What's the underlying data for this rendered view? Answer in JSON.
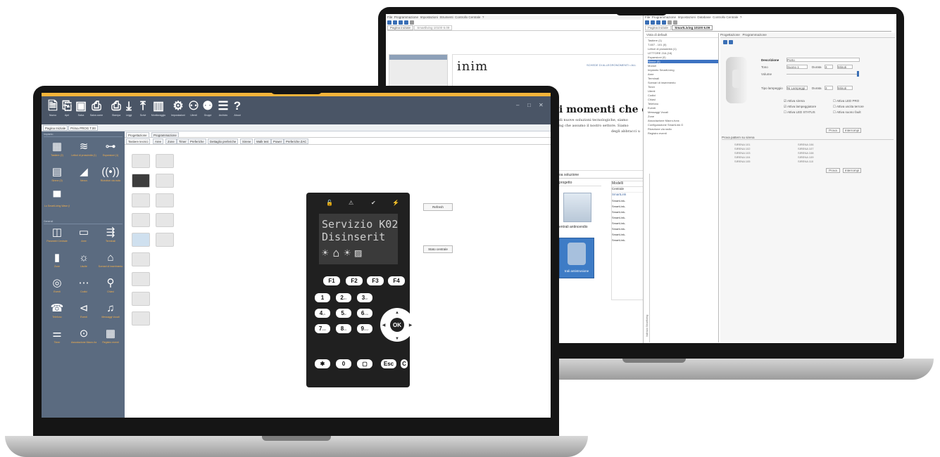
{
  "back_app": {
    "menu": [
      "File",
      "Programmazione",
      "Impostazioni",
      "Strumenti",
      "Controllo Centrale",
      "?"
    ],
    "menu_right": [
      "File",
      "Programmazione",
      "Impostazioni",
      "Database",
      "Controllo Centrale",
      "?"
    ],
    "tabs_left": [
      "Pagina iniziale",
      "Smartliving 10100 6.09"
    ],
    "tabs_right": [
      "Pagina iniziale",
      "SmartLiving 10100 6.09"
    ],
    "brand_logo": "inim",
    "web_link": "SCHEDE DI ALLEGRONOMENTI • ALL",
    "headline": "i momenti che con",
    "paragraph_1": "di nuove soluzioni tecnologiche, siamo",
    "paragraph_2": "ng che assumo il nostro settore. Siamo",
    "paragraph_3": "degli abbracci u",
    "solution_label": "oa soluzione",
    "project_label": "progetto",
    "models_label": "Modelli",
    "central_label": "Centrale",
    "smartlink_header": "SmartLink",
    "smartlink_items": [
      "SmartLink-",
      "SmartLink-",
      "SmartLink-",
      "SmartLink-",
      "SmartLink-",
      "SmartLink-",
      "SmartLink-",
      "SmartLink-"
    ],
    "central_caption_1": "entrali antincendio",
    "central_caption_2": "trali antintrusione",
    "tree_title": "Vista di default",
    "tree_items": [
      "Tastiere (1)",
      "T-607 - 101 (0)",
      "Lettori di prossimità (1)",
      "LETTORE 216 (16)",
      "Espansioni (0)",
      "Sirene (0)",
      "Moduli",
      "Impianto SmartLiving",
      "Aree",
      "Terminali",
      "Scenari di inserimento",
      "Timer",
      "Utenti",
      "Codici",
      "Chiavi",
      "Telefono",
      "Eventi",
      "Messaggi Vocali",
      "Zone",
      "Associazione Macro-funz.",
      "Configurazione SmartLink G",
      "Ricezione via radio",
      "Registro eventi"
    ],
    "prog_tabs": [
      "Progettazione",
      "Programmazione"
    ],
    "field_description": "Descrizione",
    "field_description_value": "Porto",
    "field_tone": "Tono",
    "field_tone_value": "Suono 1",
    "field_duration": "Durata",
    "field_duration_value": "3",
    "field_unit": "Minuti",
    "field_volume": "Volume",
    "field_blink_type": "Tipo lampeggio",
    "field_blink_value": "Ni Lampeggi",
    "field_duration_2_value": "3",
    "chk_sirena": "Attiva sirena",
    "chk_lampeggiatore": "Attiva lampeggiatore",
    "chk_led_status": "Attiva LED STATUS",
    "chk_led_pro": "Attiva LED PRO",
    "chk_uscita": "Attiva uscita terrore",
    "chk_guasti": "Attiva suono fault",
    "btn_prova": "Prova",
    "btn_interrompi": "Interrompi",
    "pattern_title": "Prova pattern su sirena",
    "pattern_left": [
      "SIRENA 101",
      "SIRENA 102",
      "SIRENA 103",
      "SIRENA 104",
      "SIRENA 105"
    ],
    "pattern_right": [
      "SIRENA 106",
      "SIRENA 107",
      "SIRENA 108",
      "SIRENA 109",
      "SIRENA 110"
    ],
    "btn_prova_2": "Prova",
    "btn_interrompi_2": "Interrompi",
    "side_label": "Indirizzo Smartliving"
  },
  "front_app": {
    "toolbar": [
      {
        "label": "Nuovo",
        "icon": "new-document-icon",
        "glyph": "🗎"
      },
      {
        "label": "Apri",
        "icon": "open-icon",
        "glyph": "⎘"
      },
      {
        "label": "Salva",
        "icon": "save-icon",
        "glyph": "▣"
      },
      {
        "label": "Salva come",
        "icon": "save-as-icon",
        "glyph": "⎙"
      },
      {
        "label": "Stampa",
        "icon": "print-icon",
        "glyph": "⎙"
      },
      {
        "label": "Leggi",
        "icon": "download-icon",
        "glyph": "⤓"
      },
      {
        "label": "Scrivi",
        "icon": "upload-icon",
        "glyph": "⤒"
      },
      {
        "label": "Monitoraggio",
        "icon": "chart-icon",
        "glyph": "▥"
      },
      {
        "label": "Impostazioni",
        "icon": "gear-icon",
        "glyph": "⚙"
      },
      {
        "label": "Utenti",
        "icon": "user-icon",
        "glyph": "⚇"
      },
      {
        "label": "Gruppi",
        "icon": "users-icon",
        "glyph": "⚉"
      },
      {
        "label": "Archivio",
        "icon": "database-icon",
        "glyph": "☰"
      },
      {
        "label": "About",
        "icon": "help-icon",
        "glyph": "?"
      }
    ],
    "window_controls": [
      "–",
      "□",
      "✕"
    ],
    "tabs": [
      "Pagina Iniziale",
      "Prima PROG T.00"
    ],
    "side_section_1": "Impianto",
    "side_section_2": "Generali",
    "side_items_1": [
      {
        "label": "Tastiere (2)",
        "icon": "keypad-icon",
        "glyph": "▦"
      },
      {
        "label": "Lettori di prossimità (1)",
        "icon": "wifi-icon",
        "glyph": "≋"
      },
      {
        "label": "Espansioni (1)",
        "icon": "network-icon",
        "glyph": "⊶"
      },
      {
        "label": "Sirene (0)",
        "icon": "panel-icon",
        "glyph": "▤"
      },
      {
        "label": "Nexus",
        "icon": "signal-icon",
        "glyph": "◢"
      },
      {
        "label": "Ricevitori via radio",
        "icon": "radio-icon",
        "glyph": "((•))"
      },
      {
        "label": "Lo SmartLiving Wave (0)",
        "icon": "module-icon",
        "glyph": "▀"
      }
    ],
    "side_items_2": [
      {
        "label": "Parametri Centrale",
        "icon": "control-panel-icon",
        "glyph": "◫"
      },
      {
        "label": "Aree",
        "icon": "areas-icon",
        "glyph": "▭"
      },
      {
        "label": "Terminali",
        "icon": "terminals-icon",
        "glyph": "⇶"
      },
      {
        "label": "Zone",
        "icon": "zone-icon",
        "glyph": "▮"
      },
      {
        "label": "Uscite",
        "icon": "light-icon",
        "glyph": "☼"
      },
      {
        "label": "Scenari di inserimento",
        "icon": "scenarios-icon",
        "glyph": "⌂"
      },
      {
        "label": "Eventi",
        "icon": "events-icon",
        "glyph": "◎"
      },
      {
        "label": "Codici",
        "icon": "codes-icon",
        "glyph": "⋯"
      },
      {
        "label": "Chiavi",
        "icon": "key-icon",
        "glyph": "⚲"
      },
      {
        "label": "Telefono",
        "icon": "phone-icon",
        "glyph": "☎"
      },
      {
        "label": "Eventi",
        "icon": "messages-icon",
        "glyph": "⊲"
      },
      {
        "label": "Messaggi Vocali",
        "icon": "bell-icon",
        "glyph": "♫"
      },
      {
        "label": "Timer",
        "icon": "timer-icon",
        "glyph": "⚌"
      },
      {
        "label": "Associazione Macro-funzioni",
        "icon": "play-icon",
        "glyph": "⊙"
      },
      {
        "label": "Registro eventi",
        "icon": "log-icon",
        "glyph": "▦"
      }
    ],
    "main_tabs": [
      "Progettazione",
      "Programmazione"
    ],
    "sub_tabs": [
      "Tastiere tecnici",
      "Aree",
      "Zone",
      "Timer",
      "Preferiche",
      "Dettaglio preferiche",
      "Sirene",
      "Walk test",
      "Power",
      "Preferiche ZAC"
    ],
    "btn_refresh": "Refresh",
    "btn_stato_centrale": "Stato centrale",
    "keypad": {
      "leds": [
        "🔓",
        "⚠",
        "✔",
        "⚡"
      ],
      "lcd_line_1": "Servizio K02",
      "lcd_line_2": "Disinserit",
      "function_keys": [
        "F1",
        "F2",
        "F3",
        "F4"
      ],
      "digit_keys": [
        {
          "d": "1",
          "s": ""
        },
        {
          "d": "2",
          "s": "abc"
        },
        {
          "d": "3",
          "s": "def"
        },
        {
          "d": "4",
          "s": "ghi"
        },
        {
          "d": "5",
          "s": "jkl"
        },
        {
          "d": "6",
          "s": "mno"
        },
        {
          "d": "7",
          "s": "pqrs"
        },
        {
          "d": "8",
          "s": "tuv"
        },
        {
          "d": "9",
          "s": "wxyz"
        }
      ],
      "bottom_keys": [
        "✱",
        "0",
        "▢",
        "Esc",
        "C"
      ],
      "ok_label": "OK"
    }
  }
}
